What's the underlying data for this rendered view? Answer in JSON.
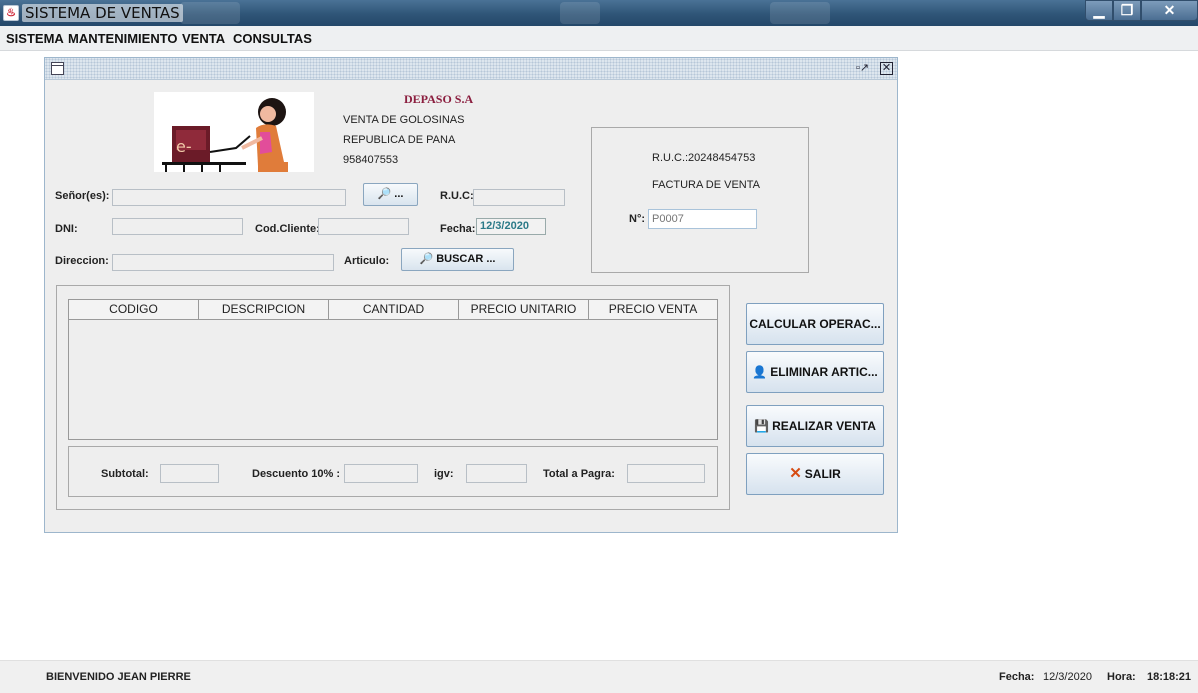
{
  "window": {
    "title": "SISTEMA DE VENTAS"
  },
  "menu": [
    "SISTEMA",
    "MANTENIMIENTO",
    "VENTA",
    "CONSULTAS"
  ],
  "company": {
    "name": "DEPASO S.A",
    "line1": "VENTA DE GOLOSINAS",
    "line2": "REPUBLICA DE PANA",
    "phone": "958407553",
    "logo_text": "e-"
  },
  "form": {
    "senores_label": "Señor(es):",
    "senores_value": "",
    "search_client_label": "...",
    "ruc_label": "R.U.C:",
    "ruc_value": "",
    "dni_label": "DNI:",
    "dni_value": "",
    "codcliente_label": "Cod.Cliente:",
    "codcliente_value": "",
    "fecha_label": "Fecha:",
    "fecha_value": "12/3/2020",
    "direccion_label": "Direccion:",
    "direccion_value": "",
    "articulo_label": "Articulo:",
    "buscar_label": "BUSCAR ..."
  },
  "invoice": {
    "ruc": "R.U.C.:20248454753",
    "title": "FACTURA DE VENTA",
    "number_label": "N°:",
    "number_placeholder": "P0007"
  },
  "table": {
    "columns": [
      "CODIGO",
      "DESCRIPCION",
      "CANTIDAD",
      "PRECIO UNITARIO",
      "PRECIO VENTA"
    ],
    "rows": []
  },
  "totals": {
    "subtotal_label": "Subtotal:",
    "descuento_label": "Descuento 10% :",
    "igv_label": "igv:",
    "total_label": "Total a Pagra:"
  },
  "actions": {
    "calcular": "CALCULAR OPERAC...",
    "eliminar": "ELIMINAR ARTIC...",
    "realizar": "REALIZAR VENTA",
    "salir": "SALIR"
  },
  "status": {
    "welcome": "BIENVENIDO  JEAN PIERRE",
    "fecha_label": "Fecha:",
    "fecha_value": "12/3/2020",
    "hora_label": "Hora:",
    "hora_value": "18:18:21"
  },
  "colors": {
    "company_name": "#8b1e3f",
    "date_value": "#2b7a88",
    "titlebar": "#2f5577"
  }
}
